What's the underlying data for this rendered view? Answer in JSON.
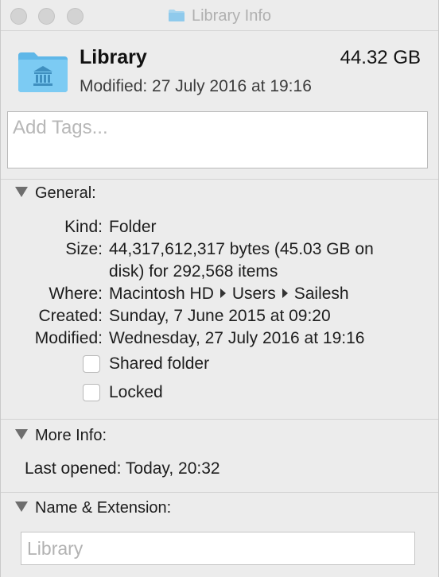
{
  "window": {
    "title": "Library Info"
  },
  "header": {
    "name": "Library",
    "size": "44.32 GB",
    "modified": "Modified: 27 July 2016 at 19:16",
    "icon": "library-folder-icon"
  },
  "tags": {
    "placeholder": "Add Tags..."
  },
  "general": {
    "heading": "General:",
    "rows": [
      {
        "label": "Kind:",
        "value": "Folder"
      },
      {
        "label": "Size:",
        "value_line1": "44,317,612,317 bytes (45.03 GB on",
        "value_line2": "disk) for 292,568 items"
      },
      {
        "label": "Where:",
        "path": [
          "Macintosh HD",
          "Users",
          "Sailesh"
        ]
      },
      {
        "label": "Created:",
        "value": "Sunday, 7 June 2015 at 09:20"
      },
      {
        "label": "Modified:",
        "value": "Wednesday, 27 July 2016 at 19:16"
      }
    ],
    "shared_folder_label": "Shared folder",
    "shared_folder_checked": false,
    "locked_label": "Locked",
    "locked_checked": false
  },
  "more_info": {
    "heading": "More Info:",
    "last_opened": "Last opened: Today, 20:32"
  },
  "name_extension": {
    "heading": "Name & Extension:",
    "placeholder": "Library"
  },
  "colors": {
    "folder_blue": "#6cc3f0",
    "window_bg": "#ececec",
    "traffic_light_inactive": "#d3d3d3"
  }
}
